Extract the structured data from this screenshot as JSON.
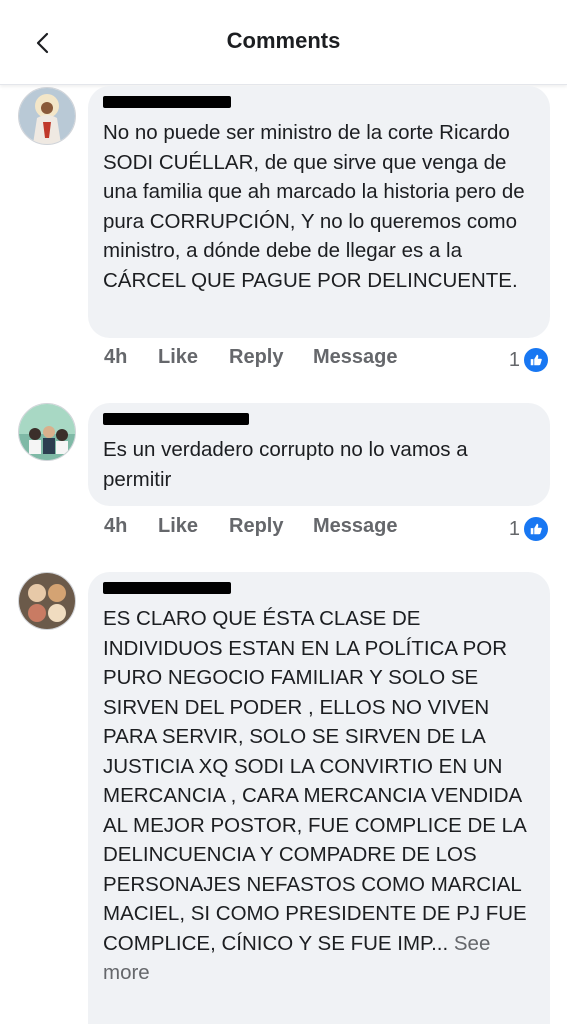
{
  "header": {
    "title": "Comments"
  },
  "comments": [
    {
      "text": "No no puede ser ministro de la corte Ricardo SODI CUÉLLAR, de que sirve que venga de una familia que ah marcado la historia pero de pura CORRUPCIÓN, Y no lo queremos como ministro, a dónde debe de llegar es a la CÁRCEL QUE PAGUE POR DELINCUENTE.",
      "time": "4h",
      "like": "Like",
      "reply": "Reply",
      "message": "Message",
      "reactions": "1"
    },
    {
      "text": "Es un verdadero corrupto no lo vamos a permitir",
      "time": "4h",
      "like": "Like",
      "reply": "Reply",
      "message": "Message",
      "reactions": "1"
    },
    {
      "text": "ES CLARO QUE ÉSTA CLASE DE INDIVIDUOS ESTAN EN LA POLÍTICA POR PURO NEGOCIO FAMILIAR Y SOLO SE SIRVEN DEL PODER , ELLOS NO VIVEN PARA SERVIR, SOLO SE SIRVEN DE LA JUSTICIA XQ SODI LA CONVIRTIO EN UN MERCANCIA , CARA MERCANCIA VENDIDA AL MEJOR POSTOR, FUE COMPLICE DE LA DELINCUENCIA Y COMPADRE DE LOS PERSONAJES NEFASTOS COMO MARCIAL MACIEL, SI COMO PRESIDENTE DE PJ FUE COMPLICE, CÍNICO Y SE FUE IMP...",
      "see_more": "See more"
    }
  ],
  "colors": {
    "accent": "#1877f2",
    "bubble": "#f0f2f5",
    "secondary_text": "#65676b"
  },
  "icons": {
    "back": "chevron-left-icon",
    "reaction": "thumbs-up-icon"
  }
}
